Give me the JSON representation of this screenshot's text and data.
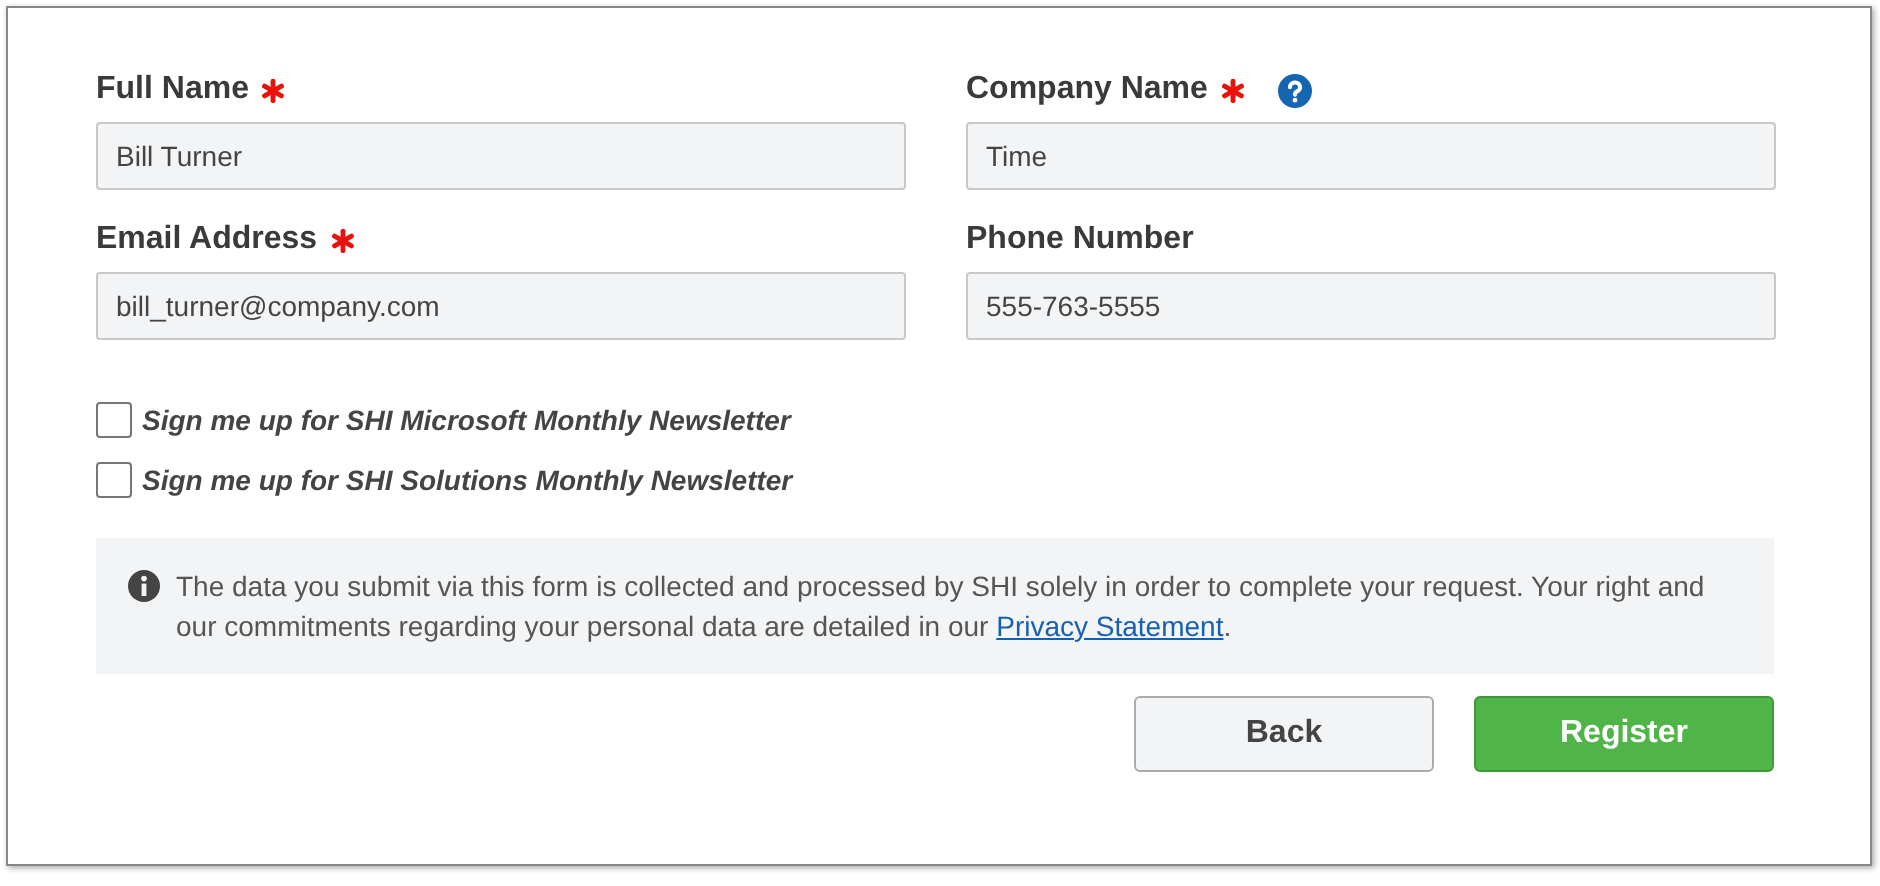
{
  "fields": [
    {
      "label": "Full Name",
      "required": true,
      "help": false,
      "value": "Bill Turner"
    },
    {
      "label": "Company Name",
      "required": true,
      "help": true,
      "value": "Time"
    },
    {
      "label": "Email Address",
      "required": true,
      "help": false,
      "value": "bill_turner@company.com"
    },
    {
      "label": "Phone Number",
      "required": false,
      "help": false,
      "value": "555-763-5555"
    }
  ],
  "checkboxes": [
    {
      "label": "Sign me up for SHI Microsoft Monthly Newsletter",
      "checked": false
    },
    {
      "label": "Sign me up for SHI Solutions Monthly Newsletter",
      "checked": false
    }
  ],
  "notice": {
    "text": "The data you submit via this form is collected and processed by SHI solely in order to complete your request. Your right and our commitments regarding your personal data are detailed in our",
    "link": "Privacy Statement",
    "after": "."
  },
  "buttons": [
    {
      "label": "Back",
      "kind": "secondary"
    },
    {
      "label": "Register",
      "kind": "primary"
    }
  ]
}
